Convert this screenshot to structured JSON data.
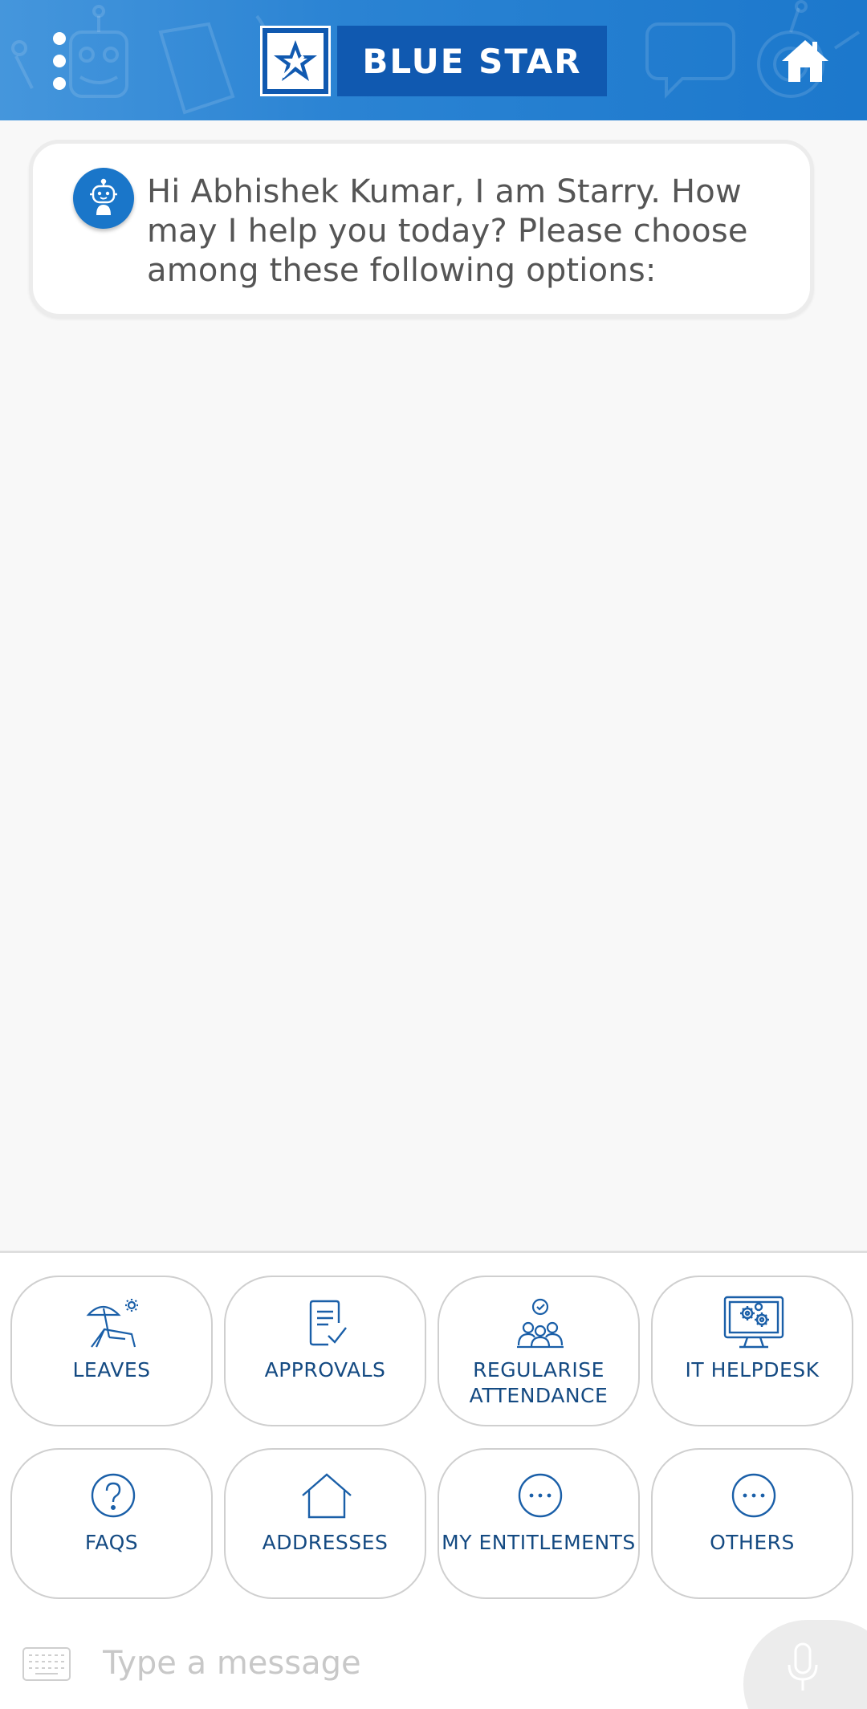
{
  "header": {
    "brand": "BLUE STAR",
    "menu_icon": "more-vertical-icon",
    "home_icon": "home-icon",
    "gradient_start": "#4596dc",
    "gradient_end": "#1c78cc"
  },
  "chat": {
    "messages": [
      {
        "sender": "bot",
        "avatar_icon": "bot-avatar-icon",
        "text": "Hi Abhishek Kumar, I am Starry. How may I help you today? Please choose among these following options:"
      }
    ]
  },
  "options": [
    {
      "label": "LEAVES",
      "icon": "beach-chair-icon"
    },
    {
      "label": "APPROVALS",
      "icon": "document-check-icon"
    },
    {
      "label": "REGULARISE ATTENDANCE",
      "icon": "team-check-icon"
    },
    {
      "label": "IT HELPDESK",
      "icon": "monitor-gears-icon"
    },
    {
      "label": "FAQS",
      "icon": "question-circle-icon"
    },
    {
      "label": "ADDRESSES",
      "icon": "house-outline-icon"
    },
    {
      "label": "MY ENTITLEMENTS",
      "icon": "more-circle-icon"
    },
    {
      "label": "OTHERS",
      "icon": "more-circle-icon"
    }
  ],
  "input": {
    "placeholder": "Type a message",
    "value": "",
    "keyboard_icon": "keyboard-icon",
    "mic_icon": "microphone-icon"
  },
  "colors": {
    "accent": "#1a76c9",
    "brand_dark": "#1059b0",
    "option_text": "#144a82",
    "background": "#f8f8f8"
  }
}
